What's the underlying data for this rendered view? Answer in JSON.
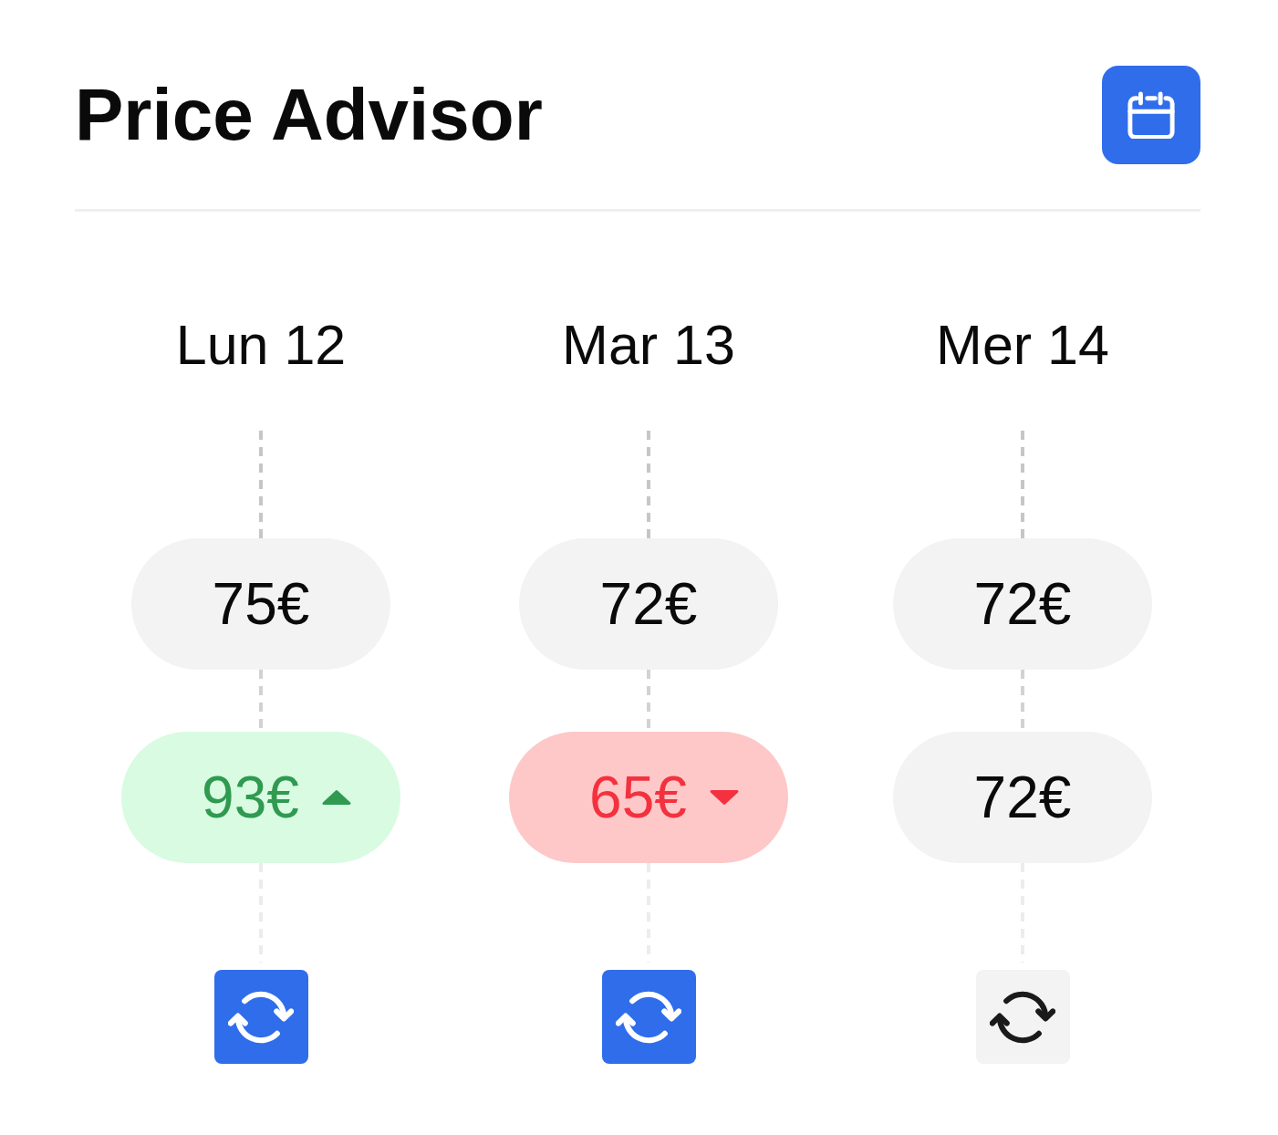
{
  "title": "Price Advisor",
  "days": [
    {
      "label": "Lun 12",
      "prices": [
        {
          "value": "75€",
          "kind": "plain"
        },
        {
          "value": "93€",
          "kind": "rise"
        }
      ],
      "refresh": {
        "selected": true
      }
    },
    {
      "label": "Mar 13",
      "prices": [
        {
          "value": "72€",
          "kind": "plain"
        },
        {
          "value": "65€",
          "kind": "drop"
        }
      ],
      "refresh": {
        "selected": true
      }
    },
    {
      "label": "Mer 14",
      "prices": [
        {
          "value": "72€",
          "kind": "plain"
        },
        {
          "value": "72€",
          "kind": "plain"
        }
      ],
      "refresh": {
        "selected": false
      }
    }
  ]
}
